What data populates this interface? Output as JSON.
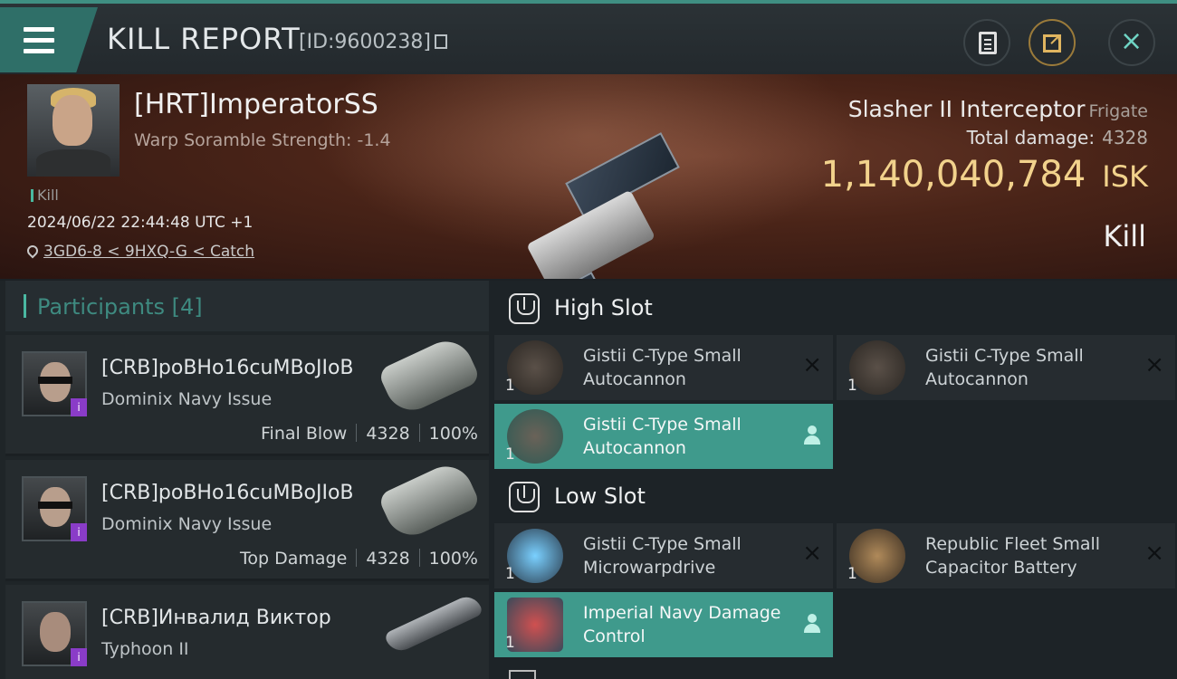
{
  "header": {
    "title": "KILL REPORT",
    "report_id": "[ID:9600238]"
  },
  "victim": {
    "name": "[HRT]ImperatorSS",
    "warp_scramble": "Warp Soramble Strength: -1.4",
    "tag": "Kill",
    "datetime": "2024/06/22 22:44:48 UTC +1",
    "location": "3GD6-8 < 9HXQ-G < Catch",
    "ship_name": "Slasher II Interceptor",
    "ship_class": "Frigate",
    "total_damage_label": "Total damage:",
    "total_damage": "4328",
    "isk_value": "1,140,040,784",
    "isk_unit": "ISK",
    "result": "Kill"
  },
  "participants": {
    "label": "Participants [4]",
    "rows": [
      {
        "name": "[CRB]poBHo16cuMBoJIoB",
        "ship": "Dominix Navy Issue",
        "role": "Final Blow",
        "damage": "4328",
        "percent": "100%"
      },
      {
        "name": "[CRB]poBHo16cuMBoJIoB",
        "ship": "Dominix Navy Issue",
        "role": "Top Damage",
        "damage": "4328",
        "percent": "100%"
      },
      {
        "name": "[CRB]Инвалид Виктор",
        "ship": "Typhoon II",
        "role": "",
        "damage": "",
        "percent": ""
      }
    ]
  },
  "fitting": {
    "high_slot_label": "High Slot",
    "low_slot_label": "Low Slot",
    "high": [
      {
        "name": "Gistii C-Type Small Autocannon",
        "qty": "1",
        "state": "destroyed"
      },
      {
        "name": "Gistii C-Type Small Autocannon",
        "qty": "1",
        "state": "destroyed"
      },
      {
        "name": "Gistii C-Type Small Autocannon",
        "qty": "1",
        "state": "dropped"
      }
    ],
    "low": [
      {
        "name": "Gistii C-Type Small Microwarpdrive",
        "qty": "1",
        "state": "destroyed"
      },
      {
        "name": "Republic Fleet Small Capacitor Battery",
        "qty": "1",
        "state": "destroyed"
      },
      {
        "name": "Imperial Navy Damage Control",
        "qty": "1",
        "state": "dropped"
      }
    ]
  },
  "icons": {
    "close": "×",
    "destroyed": "×",
    "badge": "i"
  },
  "colors": {
    "accent_teal": "#3f9a8c",
    "isk_gold": "#f2d28c",
    "security_badge": "#8a3cc8"
  }
}
